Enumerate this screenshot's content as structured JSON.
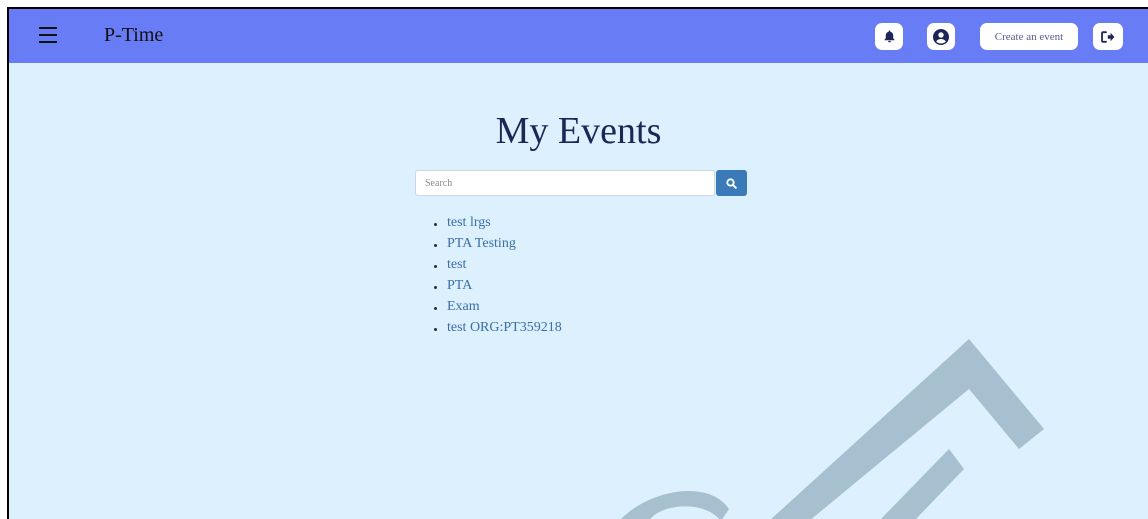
{
  "navbar": {
    "brand": "P-Time",
    "create_event_label": "Create an event",
    "icons": {
      "menu": "hamburger-menu-icon",
      "notifications": "bell-icon",
      "profile": "user-circle-icon",
      "logout": "sign-out-icon"
    },
    "background_color": "#687df5"
  },
  "main": {
    "title": "My Events",
    "search": {
      "placeholder": "Search",
      "value": "",
      "button_icon": "search-icon"
    },
    "events": [
      {
        "label": "test lrgs"
      },
      {
        "label": "PTA Testing"
      },
      {
        "label": "test"
      },
      {
        "label": "PTA"
      },
      {
        "label": "Exam"
      },
      {
        "label": "test ORG:PT359218"
      }
    ],
    "background_color": "#dcf0fd",
    "link_color": "#3a6ea8"
  }
}
